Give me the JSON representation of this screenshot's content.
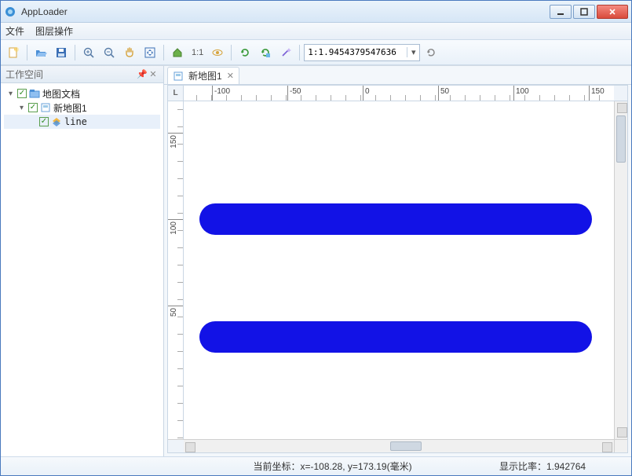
{
  "window": {
    "title": "AppLoader"
  },
  "menu": {
    "file": "文件",
    "layer": "图层操作"
  },
  "toolbar": {
    "scale_value": "1:1.9454379547636",
    "one_to_one": "1:1"
  },
  "sidebar": {
    "title": "工作空间",
    "nodes": {
      "root": {
        "label": "地图文档"
      },
      "map": {
        "label": "新地图1"
      },
      "layer": {
        "label": "line"
      }
    }
  },
  "tabs": {
    "active": "新地图1"
  },
  "ruler": {
    "corner": "L",
    "h_labels": {
      "n100": "-100",
      "n50": "-50",
      "z": "0",
      "p50": "50",
      "p100": "100",
      "p150": "150"
    },
    "v_labels": {
      "l150": "150",
      "l100": "100",
      "l50": "50"
    }
  },
  "status": {
    "coord": "当前坐标：x=-108.28, y=173.19(毫米)",
    "scale": "显示比率：1.942764"
  }
}
